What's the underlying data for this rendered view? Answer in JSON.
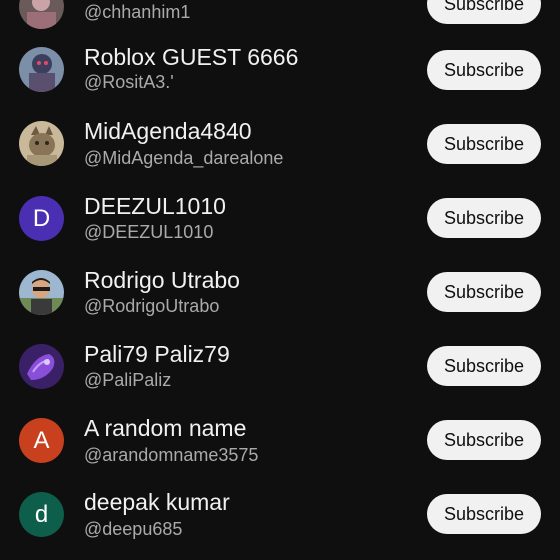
{
  "channels": [
    {
      "name": "",
      "handle": "@chhanhim1",
      "subscribe_label": "Subscribe",
      "avatar_icon": "photo-avatar"
    },
    {
      "name": "Roblox GUEST 6666",
      "handle": "@RositA3.'",
      "subscribe_label": "Subscribe",
      "avatar_icon": "photo-avatar"
    },
    {
      "name": "MidAgenda4840",
      "handle": "@MidAgenda_darealone",
      "subscribe_label": "Subscribe",
      "avatar_icon": "cat-photo-avatar"
    },
    {
      "name": "DEEZUL1010",
      "handle": "@DEEZUL1010",
      "subscribe_label": "Subscribe",
      "avatar_letter": "D",
      "avatar_color": "#4a2fb3"
    },
    {
      "name": "Rodrigo Utrabo",
      "handle": "@RodrigoUtrabo",
      "subscribe_label": "Subscribe",
      "avatar_icon": "photo-avatar"
    },
    {
      "name": "Pali79 Paliz79",
      "handle": "@PaliPaliz",
      "subscribe_label": "Subscribe",
      "avatar_icon": "purple-art-avatar"
    },
    {
      "name": "A random name",
      "handle": "@arandomname3575",
      "subscribe_label": "Subscribe",
      "avatar_letter": "A",
      "avatar_color": "#c9401f"
    },
    {
      "name": "deepak kumar",
      "handle": "@deepu685",
      "subscribe_label": "Subscribe",
      "avatar_letter": "d",
      "avatar_color": "#0d5e4a"
    }
  ],
  "colors": {
    "background": "#0f0f0f",
    "name_text": "#f1f1f1",
    "handle_text": "#aaaaaa",
    "button_bg": "#f1f1f1"
  }
}
